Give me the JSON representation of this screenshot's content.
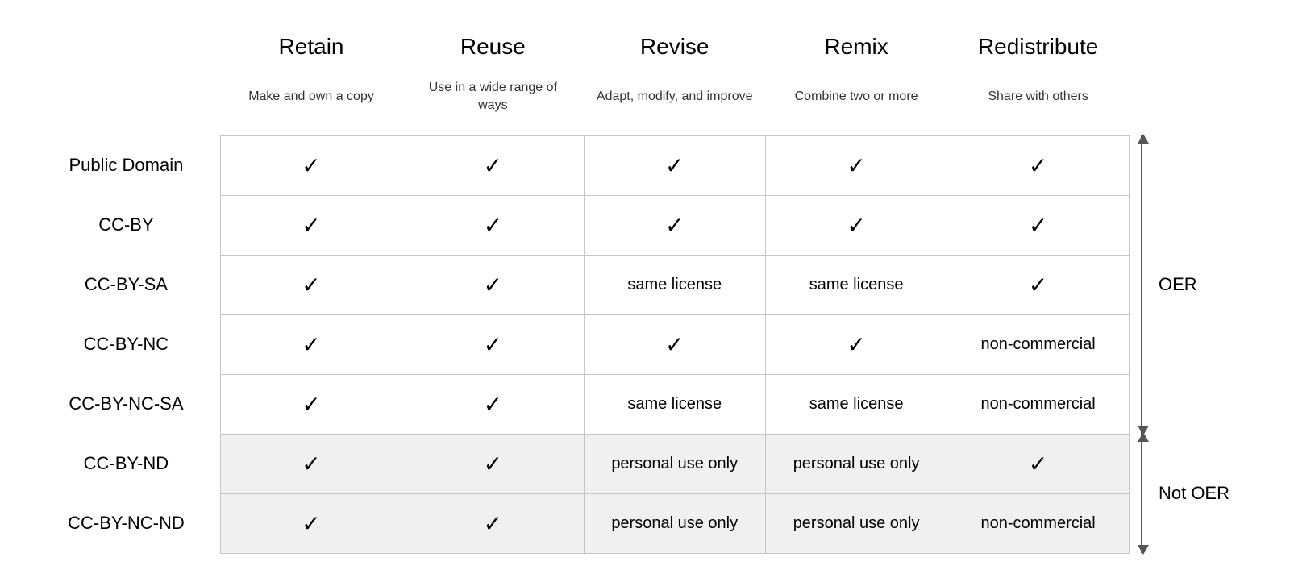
{
  "chart_data": {
    "type": "table",
    "title": "",
    "columns": [
      {
        "key": "retain",
        "title": "Retain",
        "subtitle": "Make and own a copy"
      },
      {
        "key": "reuse",
        "title": "Reuse",
        "subtitle": "Use in a wide range of ways"
      },
      {
        "key": "revise",
        "title": "Revise",
        "subtitle": "Adapt, modify, and improve"
      },
      {
        "key": "remix",
        "title": "Remix",
        "subtitle": "Combine two or more"
      },
      {
        "key": "redistribute",
        "title": "Redistribute",
        "subtitle": "Share with others"
      }
    ],
    "rows": [
      {
        "name": "Public Domain",
        "oer": true,
        "cells": {
          "retain": "check",
          "reuse": "check",
          "revise": "check",
          "remix": "check",
          "redistribute": "check"
        }
      },
      {
        "name": "CC-BY",
        "oer": true,
        "cells": {
          "retain": "check",
          "reuse": "check",
          "revise": "check",
          "remix": "check",
          "redistribute": "check"
        }
      },
      {
        "name": "CC-BY-SA",
        "oer": true,
        "cells": {
          "retain": "check",
          "reuse": "check",
          "revise": "same license",
          "remix": "same license",
          "redistribute": "check"
        }
      },
      {
        "name": "CC-BY-NC",
        "oer": true,
        "cells": {
          "retain": "check",
          "reuse": "check",
          "revise": "check",
          "remix": "check",
          "redistribute": "non-commercial"
        }
      },
      {
        "name": "CC-BY-NC-SA",
        "oer": true,
        "cells": {
          "retain": "check",
          "reuse": "check",
          "revise": "same license",
          "remix": "same license",
          "redistribute": "non-commercial"
        }
      },
      {
        "name": "CC-BY-ND",
        "oer": false,
        "cells": {
          "retain": "check",
          "reuse": "check",
          "revise": "personal use only",
          "remix": "personal use only",
          "redistribute": "check"
        }
      },
      {
        "name": "CC-BY-NC-ND",
        "oer": false,
        "cells": {
          "retain": "check",
          "reuse": "check",
          "revise": "personal use only",
          "remix": "personal use only",
          "redistribute": "non-commercial"
        }
      }
    ],
    "annotations": {
      "oer_label": "OER",
      "not_oer_label": "Not OER"
    },
    "check_glyph": "✓"
  }
}
